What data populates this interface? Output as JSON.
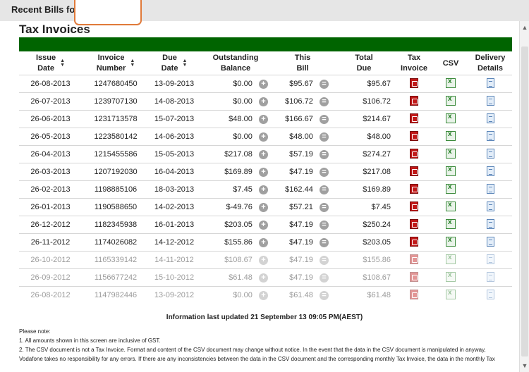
{
  "header": {
    "title": "Recent Bills for"
  },
  "page_title": "Tax Invoices",
  "columns": {
    "issue_date": [
      "Issue",
      "Date"
    ],
    "invoice_number": [
      "Invoice",
      "Number"
    ],
    "due_date": [
      "Due",
      "Date"
    ],
    "outstanding_balance": [
      "Outstanding",
      "Balance"
    ],
    "this_bill": [
      "This",
      "Bill"
    ],
    "total_due": [
      "Total",
      "Due"
    ],
    "tax_invoice": [
      "Tax",
      "Invoice"
    ],
    "csv": "CSV",
    "delivery_details": [
      "Delivery",
      "Details"
    ]
  },
  "operators": {
    "plus": "+",
    "equals": "="
  },
  "rows": [
    {
      "issue": "26-08-2013",
      "invoice": "1247680450",
      "due": "13-09-2013",
      "outstanding": "$0.00",
      "this_bill": "$95.67",
      "total": "$95.67"
    },
    {
      "issue": "26-07-2013",
      "invoice": "1239707130",
      "due": "14-08-2013",
      "outstanding": "$0.00",
      "this_bill": "$106.72",
      "total": "$106.72"
    },
    {
      "issue": "26-06-2013",
      "invoice": "1231713578",
      "due": "15-07-2013",
      "outstanding": "$48.00",
      "this_bill": "$166.67",
      "total": "$214.67"
    },
    {
      "issue": "26-05-2013",
      "invoice": "1223580142",
      "due": "14-06-2013",
      "outstanding": "$0.00",
      "this_bill": "$48.00",
      "total": "$48.00"
    },
    {
      "issue": "26-04-2013",
      "invoice": "1215455586",
      "due": "15-05-2013",
      "outstanding": "$217.08",
      "this_bill": "$57.19",
      "total": "$274.27"
    },
    {
      "issue": "26-03-2013",
      "invoice": "1207192030",
      "due": "16-04-2013",
      "outstanding": "$169.89",
      "this_bill": "$47.19",
      "total": "$217.08"
    },
    {
      "issue": "26-02-2013",
      "invoice": "1198885106",
      "due": "18-03-2013",
      "outstanding": "$7.45",
      "this_bill": "$162.44",
      "total": "$169.89"
    },
    {
      "issue": "26-01-2013",
      "invoice": "1190588650",
      "due": "14-02-2013",
      "outstanding": "$-49.76",
      "this_bill": "$57.21",
      "total": "$7.45"
    },
    {
      "issue": "26-12-2012",
      "invoice": "1182345938",
      "due": "16-01-2013",
      "outstanding": "$203.05",
      "this_bill": "$47.19",
      "total": "$250.24"
    },
    {
      "issue": "26-11-2012",
      "invoice": "1174026082",
      "due": "14-12-2012",
      "outstanding": "$155.86",
      "this_bill": "$47.19",
      "total": "$203.05"
    },
    {
      "issue": "26-10-2012",
      "invoice": "1165339142",
      "due": "14-11-2012",
      "outstanding": "$108.67",
      "this_bill": "$47.19",
      "total": "$155.86"
    },
    {
      "issue": "26-09-2012",
      "invoice": "1156677242",
      "due": "15-10-2012",
      "outstanding": "$61.48",
      "this_bill": "$47.19",
      "total": "$108.67"
    },
    {
      "issue": "26-08-2012",
      "invoice": "1147982446",
      "due": "13-09-2012",
      "outstanding": "$0.00",
      "this_bill": "$61.48",
      "total": "$61.48"
    }
  ],
  "updated_text": "Information last updated 21 September 13 09:05 PM(AEST)",
  "notes": {
    "heading": "Please note:",
    "line1": "1. All amounts shown in this screen are inclusive of GST.",
    "line2": "2. The CSV document is not a Tax Invoice. Format and content of the CSV document may change without notice. In the event that the data in the CSV document is manipulated in anyway,",
    "line3": "Vodafone takes no responsibility for any errors. If there are any inconsistencies between the data in the CSV document and the corresponding monthly Tax Invoice, the data in the monthly Tax"
  }
}
